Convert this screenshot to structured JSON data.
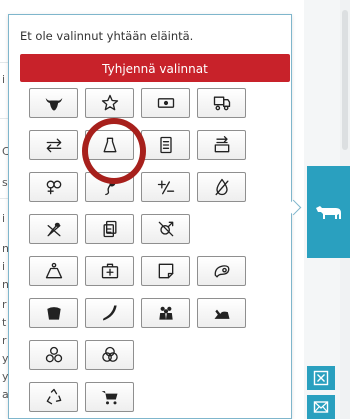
{
  "filter_popup": {
    "message": "Et ole valinnut yhtään eläintä.",
    "clear_button_label": "Tyhjennä valinnat",
    "icon_buttons": [
      "bull-head-icon",
      "star-icon",
      "banknote-icon",
      "livestock-truck-icon",
      "transfer-arrows-icon",
      "weight-icon",
      "document-icon",
      "transport-exchange-icon",
      "gender-symbols-icon",
      "insemination-icon",
      "plus-minus-icon",
      "drop-slash-icon",
      "crossed-sperm-icon",
      "copy-documents-icon",
      "male-slash-icon",
      "scale-icon",
      "medical-kit-icon",
      "note-icon",
      "sausage-icon",
      "bucket-icon",
      "horn-icon",
      "group-icon",
      "feeding-icon",
      "three-circles-icon",
      "overlapping-circles-icon",
      "recycle-icon",
      "cart-icon"
    ]
  },
  "side_panel": {
    "animal_tab_icon": "cow-icon",
    "button_icons": [
      "close-box-icon",
      "mail-icon"
    ],
    "accent_color": "#2aa0bf"
  },
  "colors": {
    "clear_button": "#c8222a",
    "highlight_ring": "#a7201c",
    "popup_border": "#7fb6cc"
  },
  "background_letters": [
    "i",
    "C",
    "s",
    "i",
    "n",
    "i",
    "n",
    "r",
    "t",
    "r",
    "y",
    "y",
    "a"
  ]
}
